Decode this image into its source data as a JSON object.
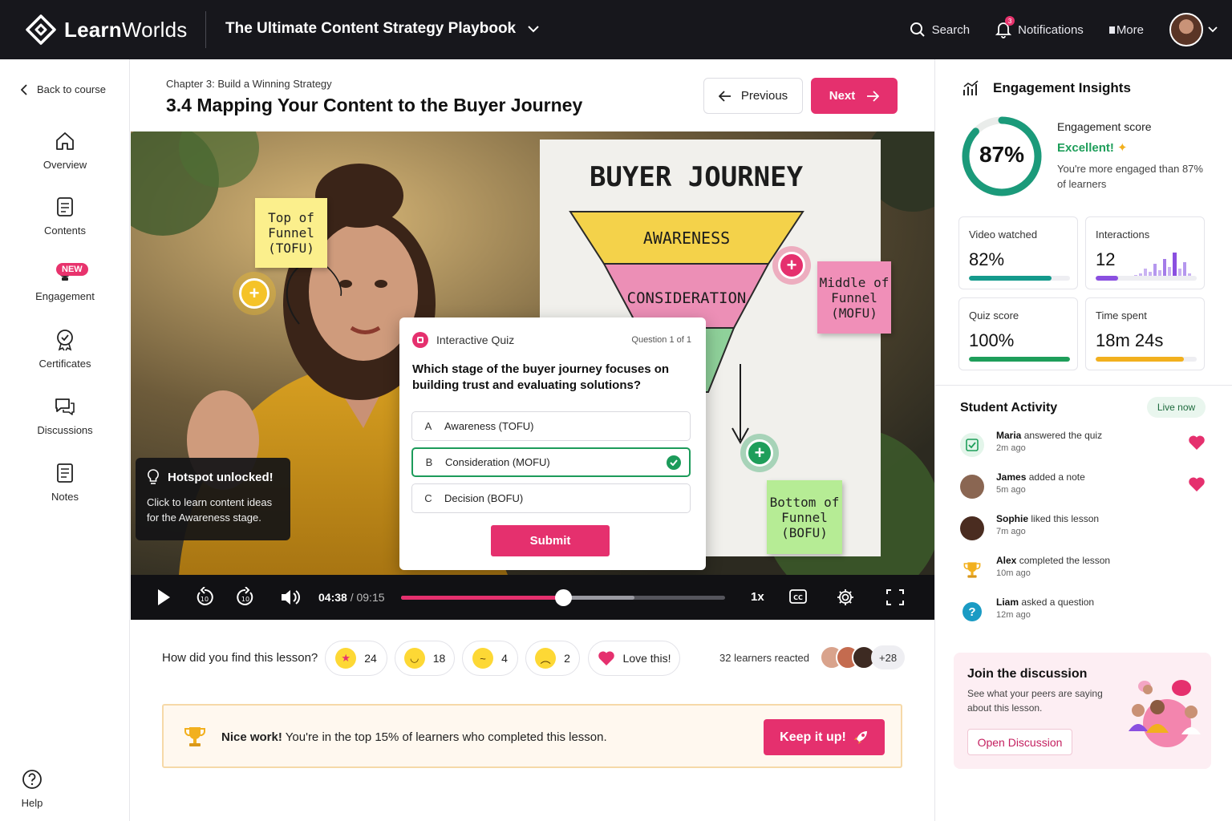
{
  "topbar": {
    "logo_bold": "Learn",
    "logo_light": "Worlds",
    "course_title": "The Ultimate Content Strategy Playbook",
    "search_label": "Search",
    "notifications_label": "Notifications",
    "notifications_count": "3",
    "more_label": "More"
  },
  "sidebar": {
    "back_label": "Back to course",
    "items": [
      {
        "label": "Overview"
      },
      {
        "label": "Contents"
      },
      {
        "label": "Engagement",
        "badge": "NEW"
      },
      {
        "label": "Certificates"
      },
      {
        "label": "Discussions"
      },
      {
        "label": "Notes"
      }
    ],
    "help_label": "Help"
  },
  "lesson": {
    "chapter": "Chapter 3: Build a Winning Strategy",
    "title": "3.4 Mapping Your Content to the Buyer Journey",
    "prev_label": "Previous",
    "next_label": "Next"
  },
  "video": {
    "board_title": "BUYER JOURNEY",
    "stage_awareness": "AWARENESS",
    "stage_consideration": "CONSIDERATION",
    "sticky_tofu": "Top of\nFunnel\n(TOFU)",
    "sticky_mofu": "Middle of\nFunnel\n(MOFU)",
    "sticky_bofu": "Bottom of\nFunnel\n(BOFU)",
    "tooltip_title": "Hotspot unlocked!",
    "tooltip_body": "Click to learn content ideas for the Awareness stage.",
    "current_time": "04:38",
    "separator": "/",
    "total_time": "09:15",
    "progress": 0.5,
    "speed": "1x"
  },
  "quiz": {
    "heading": "Interactive Quiz",
    "counter": "Question 1 of 1",
    "question": "Which stage of the buyer journey focuses on building trust and evaluating solutions?",
    "options": [
      {
        "letter": "A",
        "text": "Awareness (TOFU)"
      },
      {
        "letter": "B",
        "text": "Consideration (MOFU)"
      },
      {
        "letter": "C",
        "text": "Decision (BOFU)"
      }
    ],
    "selected": "B",
    "submit_label": "Submit"
  },
  "reactions": {
    "question": "How did you find this lesson?",
    "items": [
      {
        "emoji": "star-eyes",
        "count": "24"
      },
      {
        "emoji": "smile",
        "count": "18"
      },
      {
        "emoji": "thinking",
        "count": "4"
      },
      {
        "emoji": "worried",
        "count": "2"
      }
    ],
    "love_label": "Love this!",
    "reacted_text": "32 learners reacted",
    "more_reactors": "+28"
  },
  "banner": {
    "bold": "Nice work!",
    "text": "You're in the top 15% of learners who completed this lesson.",
    "button_label": "Keep it up!"
  },
  "insights": {
    "title": "Engagement Insights",
    "score_value": "87%",
    "score_fraction": 0.87,
    "score_label": "Engagement score",
    "score_rating": "Excellent!",
    "score_desc": "You're more engaged than 87% of learners",
    "stats": [
      {
        "label": "Video watched",
        "value": "82%",
        "fill": 0.82,
        "color": "#149a8c"
      },
      {
        "label": "Interactions",
        "value": "12",
        "fill": 0.22,
        "color": "#8a4fe0"
      },
      {
        "label": "Quiz score",
        "value": "100%",
        "fill": 1.0,
        "color": "#1e9e5a"
      },
      {
        "label": "Time spent",
        "value": "18m 24s",
        "fill": 0.87,
        "color": "#f2b01e"
      }
    ]
  },
  "activity": {
    "title": "Student Activity",
    "live_label": "Live now",
    "items": [
      {
        "name": "Maria",
        "action": "answered the quiz",
        "time": "2m ago"
      },
      {
        "name": "James",
        "action": "added a note",
        "time": "5m ago"
      },
      {
        "name": "Sophie",
        "action": "liked this lesson",
        "time": "7m ago"
      },
      {
        "name": "Alex",
        "action": "completed the lesson",
        "time": "10m ago"
      },
      {
        "name": "Liam",
        "action": "asked a question",
        "time": "12m ago"
      }
    ]
  },
  "discussion": {
    "title": "Join the discussion",
    "desc": "See what your peers are saying about this lesson.",
    "button_label": "Open Discussion"
  }
}
